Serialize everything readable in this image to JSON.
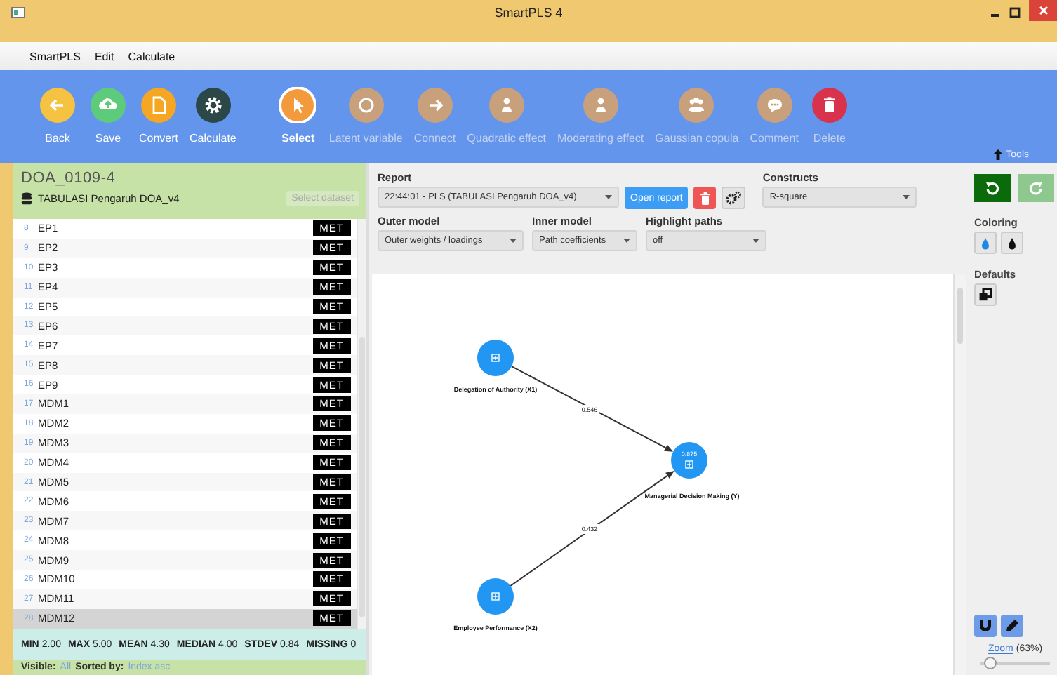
{
  "window": {
    "title": "SmartPLS 4"
  },
  "menu": [
    "SmartPLS",
    "Edit",
    "Calculate"
  ],
  "toolbar": {
    "file_tools": [
      {
        "label": "Back",
        "color": "#f5c242",
        "selected": false,
        "disabled": false
      },
      {
        "label": "Save",
        "color": "#5ecb7a",
        "selected": false,
        "disabled": false
      },
      {
        "label": "Convert",
        "color": "#f5a623",
        "selected": false,
        "disabled": false
      },
      {
        "label": "Calculate",
        "color": "#2b4747",
        "selected": false,
        "disabled": false
      }
    ],
    "edit_tools": [
      {
        "label": "Select",
        "color": "#f39a3c",
        "selected": true,
        "disabled": false
      },
      {
        "label": "Latent variable",
        "color": "#c9a07c",
        "selected": false,
        "disabled": true
      },
      {
        "label": "Connect",
        "color": "#c9a07c",
        "selected": false,
        "disabled": true
      },
      {
        "label": "Quadratic effect",
        "color": "#c9a07c",
        "selected": false,
        "disabled": true
      },
      {
        "label": "Moderating effect",
        "color": "#c9a07c",
        "selected": false,
        "disabled": true
      },
      {
        "label": "Gaussian copula",
        "color": "#c9a07c",
        "selected": false,
        "disabled": true
      },
      {
        "label": "Comment",
        "color": "#c9a07c",
        "selected": false,
        "disabled": true
      },
      {
        "label": "Delete",
        "color": "#d8324c",
        "selected": false,
        "disabled": true
      }
    ],
    "tools_toggle": "Tools"
  },
  "project": {
    "name": "DOA_0109-4",
    "dataset": "TABULASI Pengaruh DOA_v4",
    "select_button": "Select dataset"
  },
  "indicators": [
    {
      "index": "8",
      "name": "EP1",
      "badge": "MET",
      "selected": false
    },
    {
      "index": "9",
      "name": "EP2",
      "badge": "MET",
      "selected": false
    },
    {
      "index": "10",
      "name": "EP3",
      "badge": "MET",
      "selected": false
    },
    {
      "index": "11",
      "name": "EP4",
      "badge": "MET",
      "selected": false
    },
    {
      "index": "12",
      "name": "EP5",
      "badge": "MET",
      "selected": false
    },
    {
      "index": "13",
      "name": "EP6",
      "badge": "MET",
      "selected": false
    },
    {
      "index": "14",
      "name": "EP7",
      "badge": "MET",
      "selected": false
    },
    {
      "index": "15",
      "name": "EP8",
      "badge": "MET",
      "selected": false
    },
    {
      "index": "16",
      "name": "EP9",
      "badge": "MET",
      "selected": false
    },
    {
      "index": "17",
      "name": "MDM1",
      "badge": "MET",
      "selected": false
    },
    {
      "index": "18",
      "name": "MDM2",
      "badge": "MET",
      "selected": false
    },
    {
      "index": "19",
      "name": "MDM3",
      "badge": "MET",
      "selected": false
    },
    {
      "index": "20",
      "name": "MDM4",
      "badge": "MET",
      "selected": false
    },
    {
      "index": "21",
      "name": "MDM5",
      "badge": "MET",
      "selected": false
    },
    {
      "index": "22",
      "name": "MDM6",
      "badge": "MET",
      "selected": false
    },
    {
      "index": "23",
      "name": "MDM7",
      "badge": "MET",
      "selected": false
    },
    {
      "index": "24",
      "name": "MDM8",
      "badge": "MET",
      "selected": false
    },
    {
      "index": "25",
      "name": "MDM9",
      "badge": "MET",
      "selected": false
    },
    {
      "index": "26",
      "name": "MDM10",
      "badge": "MET",
      "selected": false
    },
    {
      "index": "27",
      "name": "MDM11",
      "badge": "MET",
      "selected": false
    },
    {
      "index": "28",
      "name": "MDM12",
      "badge": "MET",
      "selected": true
    }
  ],
  "statistics": [
    {
      "label": "MIN",
      "value": "2.00"
    },
    {
      "label": "MAX",
      "value": "5.00"
    },
    {
      "label": "MEAN",
      "value": "4.30"
    },
    {
      "label": "MEDIAN",
      "value": "4.00"
    },
    {
      "label": "STDEV",
      "value": "0.84"
    },
    {
      "label": "MISSING",
      "value": "0"
    }
  ],
  "list_footer": {
    "visible_label": "Visible:",
    "visible_value": "All",
    "sorted_label": "Sorted by:",
    "sorted_value": "Index asc"
  },
  "report": {
    "report_label": "Report",
    "report_value": "22:44:01 - PLS (TABULASI Pengaruh DOA_v4)",
    "open_button": "Open report",
    "constructs_label": "Constructs",
    "constructs_value": "R-square",
    "filters": [
      {
        "label": "Outer model",
        "value": "Outer weights / loadings"
      },
      {
        "label": "Inner model",
        "value": "Path coefficients"
      },
      {
        "label": "Highlight paths",
        "value": "off"
      }
    ]
  },
  "model": {
    "nodes": [
      {
        "label": "Delegation of Authority (X1)"
      },
      {
        "label": "Employee Performance (X2)"
      },
      {
        "label": "Managerial Decision Making (Y)",
        "value": "0.875"
      }
    ],
    "paths": [
      {
        "coefficient": "0.546"
      },
      {
        "coefficient": "0.432"
      }
    ]
  },
  "side": {
    "undo_enabled": true,
    "redo_enabled": false,
    "coloring_label": "Coloring",
    "defaults_label": "Defaults",
    "snap_on": true,
    "pen_on": true,
    "zoom_link": "Zoom",
    "zoom_value": "(63%)",
    "zoom": {
      "level": 0.15
    }
  }
}
